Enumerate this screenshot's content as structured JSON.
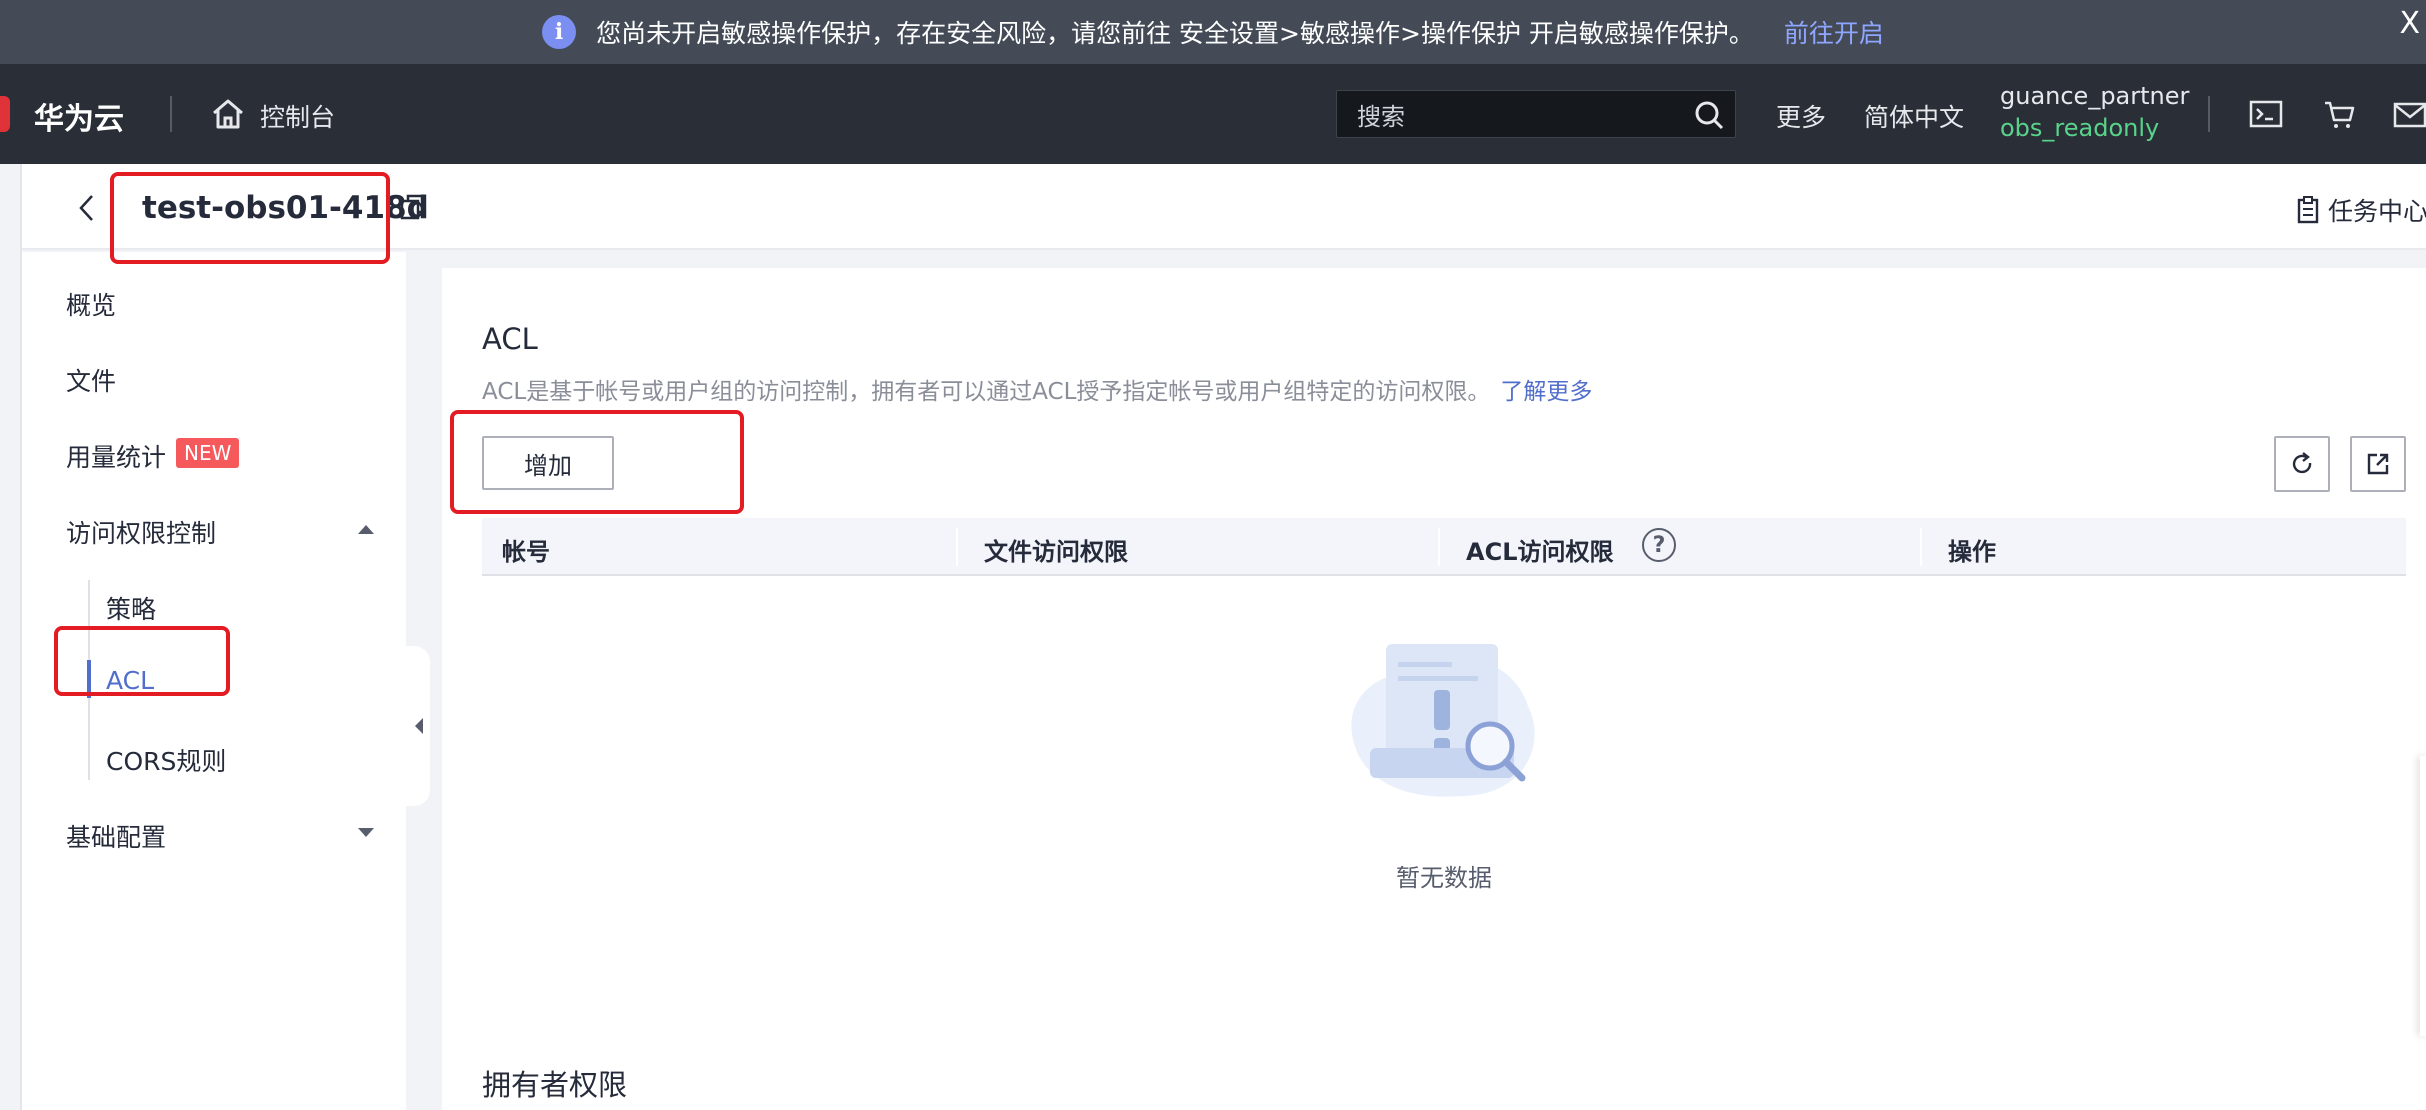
{
  "notice": {
    "message": "您尚未开启敏感操作保护，存在安全风险，请您前往 安全设置>敏感操作>操作保护 开启敏感操作保护。",
    "link": "前往开启",
    "close": "X"
  },
  "header": {
    "brand": "华为云",
    "console": "控制台",
    "search_placeholder": "搜索",
    "more": "更多",
    "language": "简体中文",
    "user_name": "guance_partner",
    "user_role": "obs_readonly"
  },
  "page": {
    "bucket_title": "test-obs01-418d",
    "task_center": "任务中心"
  },
  "sidebar": {
    "items": [
      {
        "label": "概览"
      },
      {
        "label": "文件"
      },
      {
        "label": "用量统计",
        "badge": "NEW"
      },
      {
        "label": "访问权限控制"
      },
      {
        "label": "基础配置"
      }
    ],
    "sub_items": [
      {
        "label": "策略"
      },
      {
        "label": "ACL"
      },
      {
        "label": "CORS规则"
      }
    ]
  },
  "main": {
    "section_title": "ACL",
    "section_desc": "ACL是基于帐号或用户组的访问控制，拥有者可以通过ACL授予指定帐号或用户组特定的访问权限。",
    "learn_more": "了解更多",
    "add_button": "增加",
    "table": {
      "columns": [
        "帐号",
        "文件访问权限",
        "ACL访问权限",
        "操作"
      ],
      "help": "?"
    },
    "empty_text": "暂无数据",
    "owner_title": "拥有者权限"
  },
  "colors": {
    "accent": "#526ecc",
    "highlight": "#e31b23",
    "badge": "#f6595c",
    "role": "#59d38b"
  }
}
